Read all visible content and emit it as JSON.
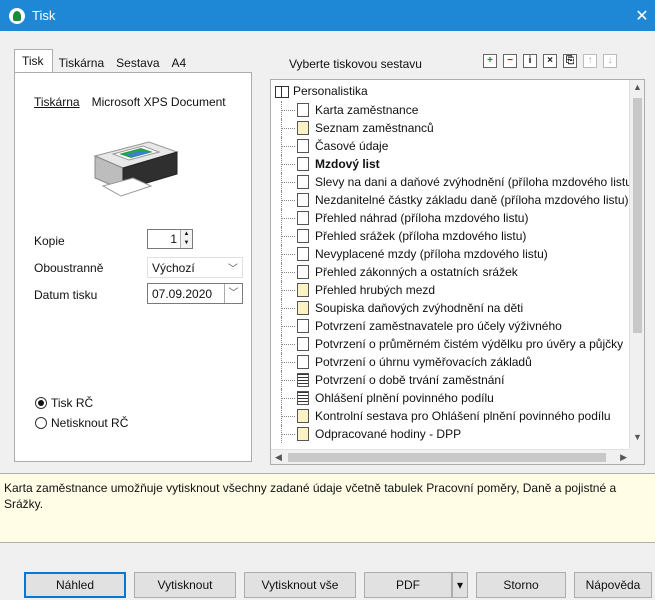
{
  "window": {
    "title": "Tisk",
    "close_glyph": "✕"
  },
  "tabs": [
    {
      "label": "Tisk",
      "active": true
    },
    {
      "label": "Tiskárna",
      "active": false
    },
    {
      "label": "Sestava",
      "active": false
    },
    {
      "label": "A4",
      "active": false
    }
  ],
  "printer": {
    "link_label": "Tiskárna",
    "name": "Microsoft XPS Document"
  },
  "form": {
    "copies_label": "Kopie",
    "copies_value": "1",
    "duplex_label": "Oboustranně",
    "duplex_value": "Výchozí",
    "date_label": "Datum tisku",
    "date_value": "07.09.2020"
  },
  "radios": [
    {
      "label": "Tisk RČ",
      "checked": true
    },
    {
      "label": "Netisknout RČ",
      "checked": false
    }
  ],
  "report_panel": {
    "label": "Vyberte tiskovou sestavu",
    "toolbar_icons": [
      {
        "name": "expand-icon",
        "glyph": "+"
      },
      {
        "name": "collapse-icon",
        "glyph": "−"
      },
      {
        "name": "info-icon",
        "glyph": "i"
      },
      {
        "name": "close-item-icon",
        "glyph": "×"
      },
      {
        "name": "copy-icon",
        "glyph": "⎘"
      },
      {
        "name": "move-up-icon",
        "glyph": "↑"
      },
      {
        "name": "move-down-icon",
        "glyph": "↓"
      }
    ]
  },
  "tree": {
    "root": "Personalistika",
    "items": [
      {
        "label": "Karta zaměstnance",
        "icon": "plain",
        "selected": true
      },
      {
        "label": "Seznam zaměstnanců",
        "icon": "yellow"
      },
      {
        "label": "Časové údaje",
        "icon": "plain"
      },
      {
        "label": "Mzdový list",
        "icon": "plain",
        "bold": true
      },
      {
        "label": "Slevy na dani a daňové zvýhodnění (příloha mzdového listu)",
        "icon": "plain"
      },
      {
        "label": "Nezdanitelné částky základu daně (příloha mzdového listu)",
        "icon": "plain"
      },
      {
        "label": "Přehled náhrad (příloha mzdového listu)",
        "icon": "plain"
      },
      {
        "label": "Přehled srážek (příloha mzdového listu)",
        "icon": "plain"
      },
      {
        "label": "Nevyplacené mzdy (příloha mzdového listu)",
        "icon": "plain"
      },
      {
        "label": "Přehled zákonných a ostatních srážek",
        "icon": "plain"
      },
      {
        "label": "Přehled hrubých mezd",
        "icon": "yellow"
      },
      {
        "label": "Soupiska daňových zvýhodnění na děti",
        "icon": "yellow"
      },
      {
        "label": "Potvrzení zaměstnavatele pro účely výživného",
        "icon": "plain"
      },
      {
        "label": "Potvrzení o průměrném čistém výdělku pro úvěry a půjčky",
        "icon": "plain"
      },
      {
        "label": "Potvrzení o úhrnu vyměřovacích základů",
        "icon": "plain"
      },
      {
        "label": "Potvrzení o době trvání zaměstnání",
        "icon": "filled"
      },
      {
        "label": "Ohlášení plnění povinného podílu",
        "icon": "filled"
      },
      {
        "label": "Kontrolní sestava pro Ohlášení plnění povinného podílu",
        "icon": "yellow"
      },
      {
        "label": "Odpracované hodiny - DPP",
        "icon": "yellow"
      }
    ]
  },
  "description": "Karta zaměstnance umožňuje vytisknout všechny zadané údaje včetně tabulek Pracovní poměry, Daně a pojistné a Srážky.",
  "buttons": {
    "preview": "Náhled",
    "print": "Vytisknout",
    "print_all": "Vytisknout vše",
    "pdf": "PDF",
    "pdf_menu": "▾",
    "cancel": "Storno",
    "help": "Nápověda"
  }
}
